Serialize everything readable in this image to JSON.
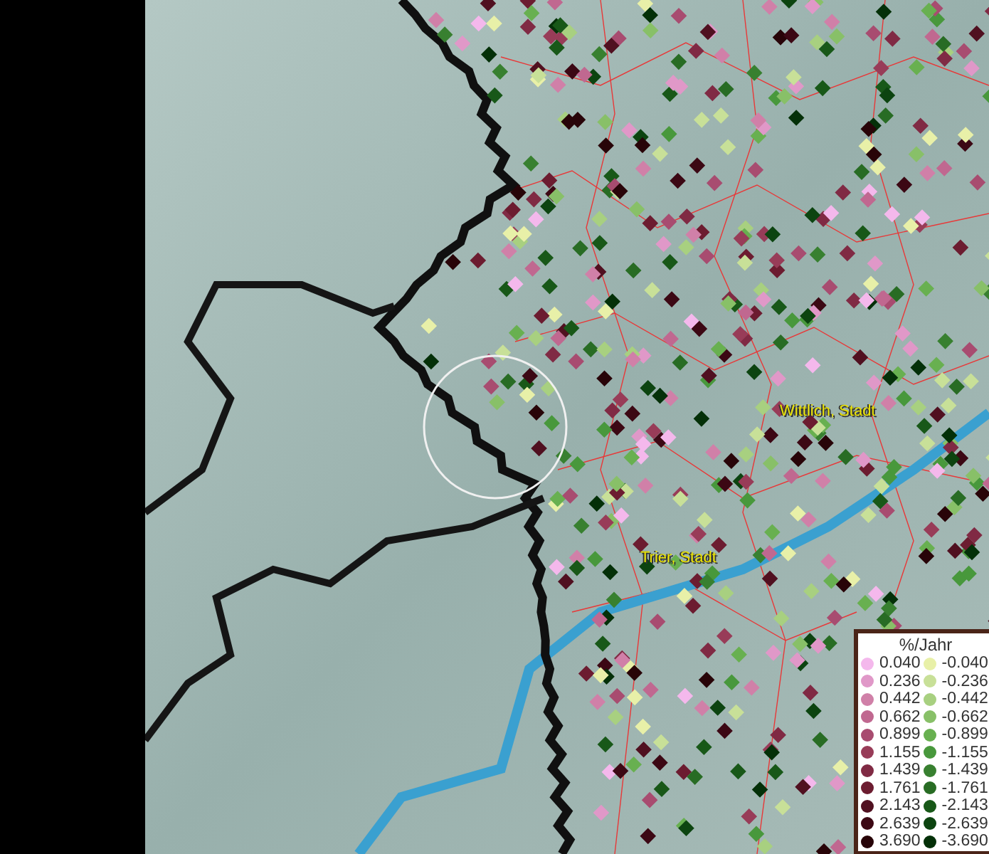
{
  "map": {
    "places": [
      {
        "name": "Wittlich, Stadt"
      },
      {
        "name": "Trier, Stadt"
      }
    ]
  },
  "legend": {
    "title": "%/Jahr",
    "columns": [
      {
        "items": [
          {
            "label": "0.040",
            "color": "#f4b8ec"
          },
          {
            "label": "0.236",
            "color": "#e098c8"
          },
          {
            "label": "0.442",
            "color": "#d080a8"
          },
          {
            "label": "0.662",
            "color": "#c06890"
          },
          {
            "label": "0.899",
            "color": "#a84c70"
          },
          {
            "label": "1.155",
            "color": "#983c58"
          },
          {
            "label": "1.439",
            "color": "#802a44"
          },
          {
            "label": "1.761",
            "color": "#6c1c30"
          },
          {
            "label": "2.143",
            "color": "#501020"
          },
          {
            "label": "2.639",
            "color": "#3c0814"
          },
          {
            "label": "3.690",
            "color": "#280408"
          }
        ]
      },
      {
        "items": [
          {
            "label": "-0.040",
            "color": "#e8f0a8"
          },
          {
            "label": "-0.236",
            "color": "#c8e098"
          },
          {
            "label": "-0.442",
            "color": "#a8d080"
          },
          {
            "label": "-0.662",
            "color": "#88c068"
          },
          {
            "label": "-0.899",
            "color": "#68b050"
          },
          {
            "label": "-1.155",
            "color": "#48983c"
          },
          {
            "label": "-1.439",
            "color": "#388030"
          },
          {
            "label": "-1.761",
            "color": "#286c24"
          },
          {
            "label": "-2.143",
            "color": "#185818"
          },
          {
            "label": "-2.639",
            "color": "#0c4410"
          },
          {
            "label": "-3.690",
            "color": "#043008"
          }
        ]
      }
    ]
  }
}
